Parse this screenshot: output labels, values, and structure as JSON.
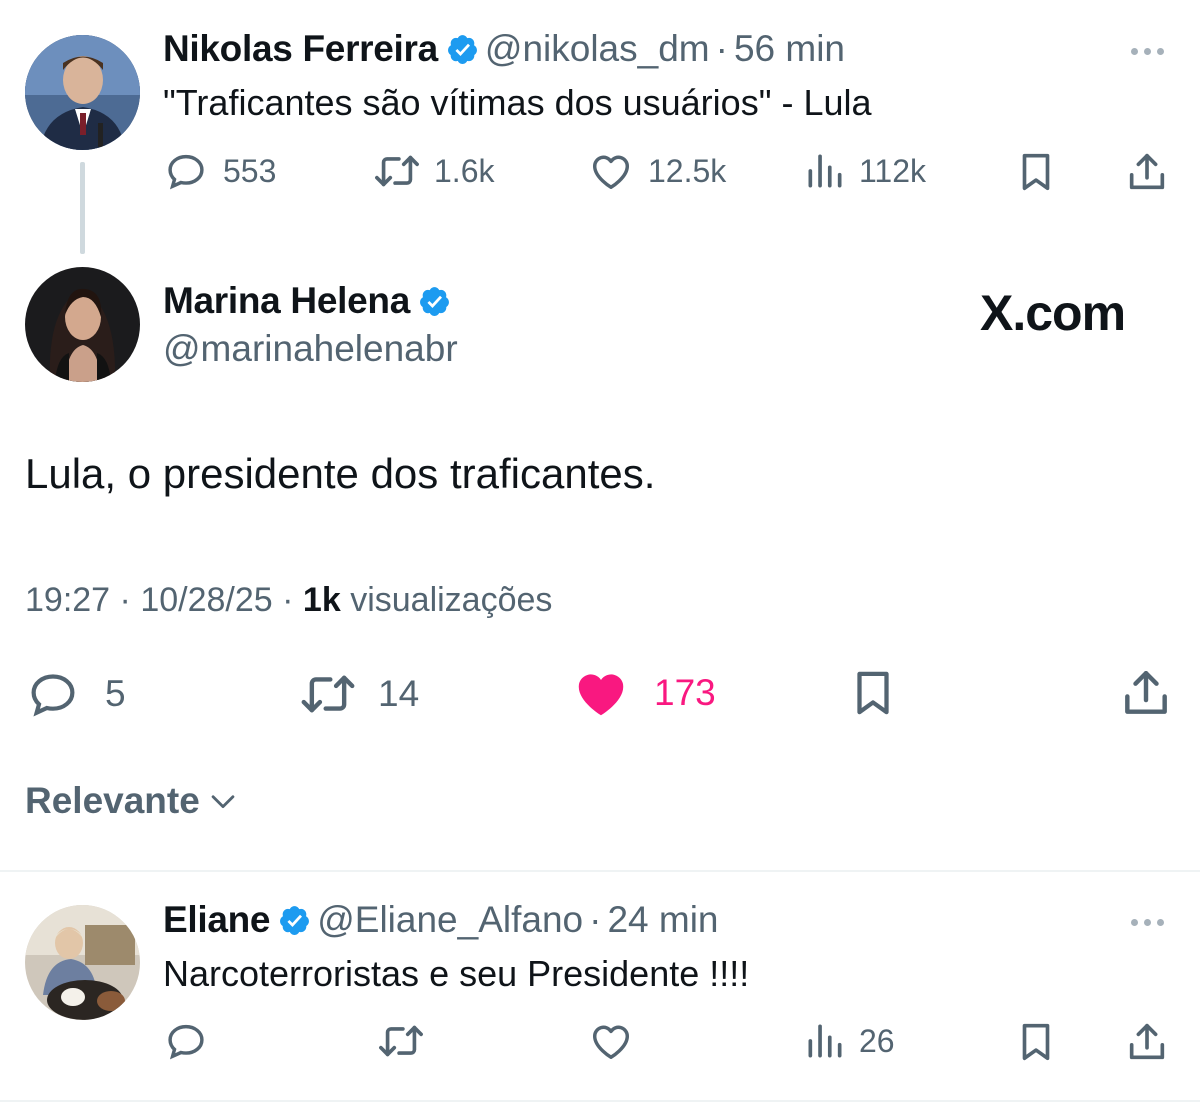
{
  "parent_tweet": {
    "author_name": "Nikolas Ferreira",
    "handle": "@nikolas_dm",
    "separator": "·",
    "time": "56 min",
    "text": "\"Traficantes são vítimas dos usuários\" - Lula",
    "replies": "553",
    "retweets": "1.6k",
    "likes": "12.5k",
    "views": "112k"
  },
  "main_tweet": {
    "author_name": "Marina Helena",
    "handle": "@marinahelenabr",
    "watermark": "X.com",
    "text": "Lula, o presidente dos traficantes.",
    "time": "19:27",
    "sep1": "·",
    "date": "10/28/25",
    "sep2": "·",
    "views_count": "1k",
    "views_label": "visualizações",
    "replies": "5",
    "retweets": "14",
    "likes": "173",
    "liked": true,
    "like_color": "#f91880"
  },
  "sort": {
    "label": "Relevante"
  },
  "reply_tweet": {
    "author_name": "Eliane",
    "handle": "@Eliane_Alfano",
    "separator": "·",
    "time": "24 min",
    "text": "Narcoterroristas e seu Presidente !!!!",
    "views": "26"
  },
  "colors": {
    "verified": "#1d9bf0",
    "text": "#0f1419",
    "secondary": "#536471",
    "like": "#f91880"
  },
  "icons": [
    "verified-badge-icon",
    "reply-icon",
    "retweet-icon",
    "like-icon",
    "views-icon",
    "bookmark-icon",
    "share-icon",
    "more-icon",
    "chevron-down-icon"
  ]
}
